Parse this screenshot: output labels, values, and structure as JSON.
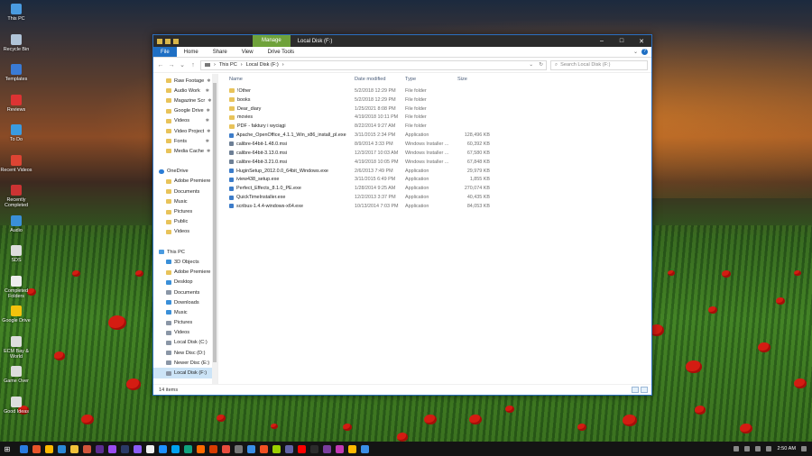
{
  "desktop": {
    "icons": [
      {
        "label": "This PC",
        "color": "#4a9be0"
      },
      {
        "label": "Recycle Bin",
        "color": "#b0c4d8"
      },
      {
        "label": "Templates",
        "color": "#3a7bd5"
      },
      {
        "label": "Reviews",
        "color": "#d33"
      },
      {
        "label": "To Do",
        "color": "#3a9be0"
      },
      {
        "label": "Recent Videos",
        "color": "#d43"
      },
      {
        "label": "Recently Completed",
        "color": "#c33"
      },
      {
        "label": "Audio",
        "color": "#3a8fd8"
      },
      {
        "label": "SDS",
        "color": "#ddd"
      },
      {
        "label": "Completed Folders",
        "color": "#eee"
      },
      {
        "label": "Google Drive",
        "color": "#f4c20d"
      },
      {
        "label": "ECM Bay & World",
        "color": "#ddd"
      },
      {
        "label": "Game Over",
        "color": "#ddd"
      },
      {
        "label": "Good Ideas",
        "color": "#ddd"
      }
    ]
  },
  "window": {
    "manage_tab": "Manage",
    "title": "Local Disk (F:)",
    "ribbon_tabs": [
      "File",
      "Home",
      "Share",
      "View",
      "Drive Tools"
    ],
    "address": {
      "root": "This PC",
      "current": "Local Disk (F:)"
    },
    "search_placeholder": "Search Local Disk (F:)",
    "nav_items": [
      {
        "label": "Raw Footage",
        "icon": "folder",
        "pinned": true,
        "level": 1
      },
      {
        "label": "Audio Work",
        "icon": "folder",
        "pinned": true,
        "level": 1
      },
      {
        "label": "Magazine Scr",
        "icon": "folder",
        "pinned": true,
        "level": 1
      },
      {
        "label": "Google Drive",
        "icon": "folder",
        "pinned": true,
        "level": 1
      },
      {
        "label": "Videos",
        "icon": "folder",
        "pinned": true,
        "level": 1
      },
      {
        "label": "Video Project",
        "icon": "folder",
        "pinned": true,
        "level": 1
      },
      {
        "label": "Fonts",
        "icon": "folder",
        "pinned": true,
        "level": 1
      },
      {
        "label": "Media Cache",
        "icon": "folder",
        "pinned": true,
        "level": 1
      },
      {
        "label": "",
        "icon": "none",
        "pinned": false,
        "level": 1
      },
      {
        "label": "OneDrive",
        "icon": "cloud",
        "pinned": false,
        "level": 0
      },
      {
        "label": "Adobe Premiere",
        "icon": "folder",
        "pinned": false,
        "level": 1
      },
      {
        "label": "Documents",
        "icon": "folder",
        "pinned": false,
        "level": 1
      },
      {
        "label": "Music",
        "icon": "folder",
        "pinned": false,
        "level": 1
      },
      {
        "label": "Pictures",
        "icon": "folder",
        "pinned": false,
        "level": 1
      },
      {
        "label": "Public",
        "icon": "folder",
        "pinned": false,
        "level": 1
      },
      {
        "label": "Videos",
        "icon": "folder",
        "pinned": false,
        "level": 1
      },
      {
        "label": "",
        "icon": "none",
        "pinned": false,
        "level": 1
      },
      {
        "label": "This PC",
        "icon": "pc",
        "pinned": false,
        "level": 0
      },
      {
        "label": "3D Objects",
        "icon": "blue",
        "pinned": false,
        "level": 1
      },
      {
        "label": "Adobe Premiere",
        "icon": "folder",
        "pinned": false,
        "level": 1
      },
      {
        "label": "Desktop",
        "icon": "blue",
        "pinned": false,
        "level": 1
      },
      {
        "label": "Documents",
        "icon": "drive",
        "pinned": false,
        "level": 1
      },
      {
        "label": "Downloads",
        "icon": "blue",
        "pinned": false,
        "level": 1
      },
      {
        "label": "Music",
        "icon": "blue",
        "pinned": false,
        "level": 1
      },
      {
        "label": "Pictures",
        "icon": "drive",
        "pinned": false,
        "level": 1
      },
      {
        "label": "Videos",
        "icon": "drive",
        "pinned": false,
        "level": 1
      },
      {
        "label": "Local Disk (C:)",
        "icon": "drive",
        "pinned": false,
        "level": 1
      },
      {
        "label": "New Disc (D:)",
        "icon": "drive",
        "pinned": false,
        "level": 1
      },
      {
        "label": "Newer Disc (E:)",
        "icon": "drive",
        "pinned": false,
        "level": 1
      },
      {
        "label": "Local Disk (F:)",
        "icon": "drive",
        "pinned": false,
        "level": 1,
        "selected": true
      },
      {
        "label": "",
        "icon": "none",
        "pinned": false,
        "level": 1
      },
      {
        "label": "Network",
        "icon": "net",
        "pinned": false,
        "level": 0
      }
    ],
    "columns": {
      "name": "Name",
      "date": "Date modified",
      "type": "Type",
      "size": "Size"
    },
    "files": [
      {
        "name": "!Other",
        "date": "5/2/2018 12:29 PM",
        "type": "File folder",
        "size": "",
        "icon": "folder"
      },
      {
        "name": "books",
        "date": "5/2/2018 12:29 PM",
        "type": "File folder",
        "size": "",
        "icon": "folder"
      },
      {
        "name": "Dear_diary",
        "date": "1/25/2021 8:08 PM",
        "type": "File folder",
        "size": "",
        "icon": "folder"
      },
      {
        "name": "movies",
        "date": "4/19/2018 10:11 PM",
        "type": "File folder",
        "size": "",
        "icon": "folder"
      },
      {
        "name": "PDF - faktury i wyciągi",
        "date": "8/22/2014 9:27 AM",
        "type": "File folder",
        "size": "",
        "icon": "folder"
      },
      {
        "name": "Apache_OpenOffice_4.1.1_Win_x86_install_pl.exe",
        "date": "3/11/2015 2:34 PM",
        "type": "Application",
        "size": "128,496 KB",
        "icon": "app"
      },
      {
        "name": "calibre-64bit-1.48.0.msi",
        "date": "8/9/2014 3:33 PM",
        "type": "Windows Installer ...",
        "size": "60,392 KB",
        "icon": "msi"
      },
      {
        "name": "calibre-64bit-3.13.0.msi",
        "date": "12/3/2017 10:03 AM",
        "type": "Windows Installer ...",
        "size": "67,580 KB",
        "icon": "msi"
      },
      {
        "name": "calibre-64bit-3.21.0.msi",
        "date": "4/19/2018 10:05 PM",
        "type": "Windows Installer ...",
        "size": "67,848 KB",
        "icon": "msi"
      },
      {
        "name": "HuginSetup_2012.0.0_64bit_Windows.exe",
        "date": "2/6/2013 7:49 PM",
        "type": "Application",
        "size": "29,979 KB",
        "icon": "app"
      },
      {
        "name": "iview438_setup.exe",
        "date": "3/11/2015 6:49 PM",
        "type": "Application",
        "size": "1,855 KB",
        "icon": "app"
      },
      {
        "name": "Perfect_Effects_8.1.0_PE.exe",
        "date": "1/28/2014 9:25 AM",
        "type": "Application",
        "size": "270,074 KB",
        "icon": "app"
      },
      {
        "name": "QuickTimeInstaller.exe",
        "date": "12/2/2013 3:37 PM",
        "type": "Application",
        "size": "40,435 KB",
        "icon": "app"
      },
      {
        "name": "scribus-1.4.4-windows-x64.exe",
        "date": "10/13/2014 7:03 PM",
        "type": "Application",
        "size": "84,053 KB",
        "icon": "app"
      }
    ],
    "status_count": "14 items"
  },
  "taskbar": {
    "apps": [
      "#2a7be0",
      "#e8542a",
      "#ffb900",
      "#2b88d8",
      "#f0c23a",
      "#d2553b",
      "#5c2d91",
      "#9a4bf0",
      "#2b3a67",
      "#8b5cf6",
      "#f0f0f0",
      "#1e90ff",
      "#00a1f1",
      "#10a37f",
      "#ff6a00",
      "#d83b01",
      "#e84c3d",
      "#777777",
      "#3a8ee6",
      "#f25022",
      "#9bd000",
      "#6264a7",
      "#ff0000",
      "#2c2c2c",
      "#7a3e9d",
      "#c239b3",
      "#ffb900",
      "#3a8ee6"
    ],
    "clock": "2:50 AM"
  }
}
